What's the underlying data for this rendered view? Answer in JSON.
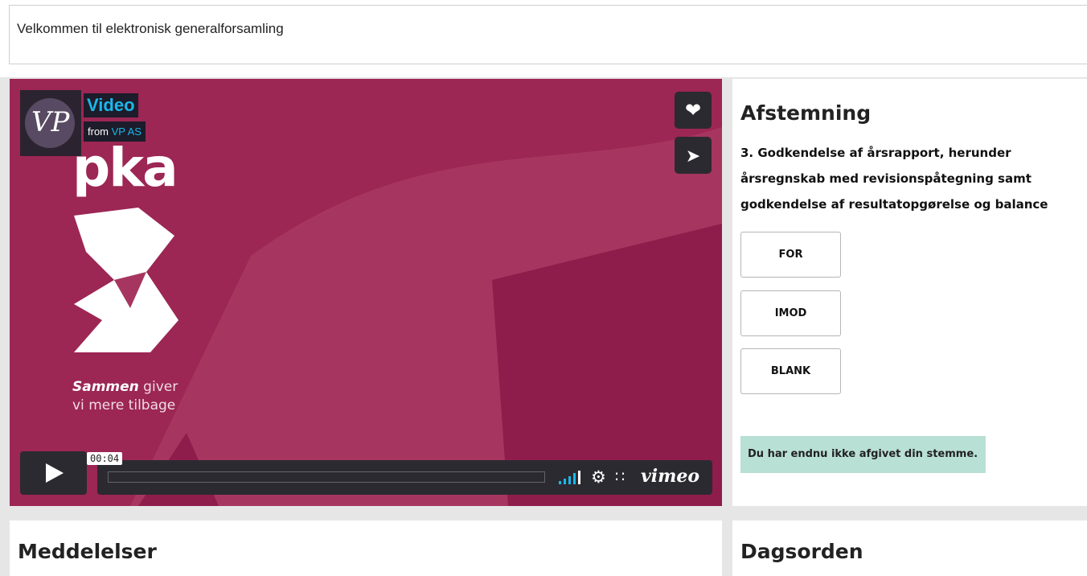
{
  "header": {
    "title": "Velkommen til elektronisk generalforsamling"
  },
  "video": {
    "title": "Video",
    "from_label": "from",
    "from_owner": "VP AS",
    "logo_text": "VP",
    "brand_word": "pka",
    "tagline_bold": "Sammen",
    "tagline_rest_1": " giver",
    "tagline_line2": "vi mere tilbage",
    "timecode": "00:04",
    "player_brand": "vimeo",
    "icons": [
      "heart-icon",
      "send-icon",
      "play-icon",
      "volume-icon",
      "settings-icon",
      "fullscreen-icon"
    ]
  },
  "vote": {
    "title": "Afstemning",
    "question": "3. Godkendelse af årsrapport, herunder årsregnskab med revisionspåtegning samt godkendelse af resultatopgørelse og balance",
    "options": [
      "FOR",
      "IMOD",
      "BLANK"
    ],
    "status": "Du har endnu ikke afgivet din stemme."
  },
  "sections": {
    "messages_title": "Meddelelser",
    "agenda_title": "Dagsorden"
  },
  "colors": {
    "video_bg": "#a6365f",
    "video_dark": "#8e1d4c",
    "accent_blue": "#1ab7ea",
    "status_bg": "#b9e0d5"
  }
}
